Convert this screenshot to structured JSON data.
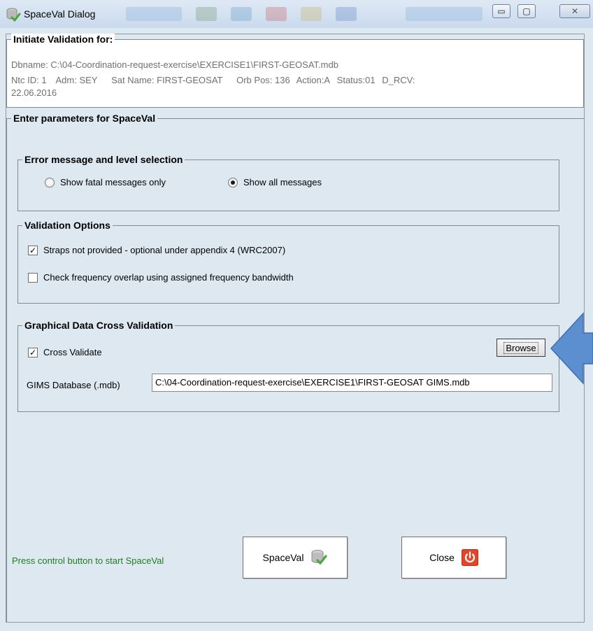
{
  "window": {
    "title": "SpaceVal Dialog",
    "minimize_glyph": "▭",
    "maximize_glyph": "▢",
    "close_glyph": "✕"
  },
  "initiate": {
    "legend": "Initiate Validation for:",
    "dbname": "Dbname:  C:\\04-Coordination-request-exercise\\EXERCISE1\\FIRST-GEOSAT.mdb",
    "ntc_id": "Ntc ID: 1",
    "adm": "Adm: SEY",
    "sat_name": "Sat Name:  FIRST-GEOSAT",
    "orb_pos": "Orb Pos: 136",
    "action": "Action:A",
    "status": "Status:01",
    "d_rcv": "D_RCV:",
    "date": "22.06.2016"
  },
  "params": {
    "legend": "Enter parameters for SpaceVal"
  },
  "error_level": {
    "legend": "Error message and level selection",
    "option_fatal": "Show fatal messages only",
    "option_all": "Show all messages",
    "selected": "all"
  },
  "validation_options": {
    "legend": "Validation Options",
    "straps_label": "Straps not provided - optional under appendix 4 (WRC2007)",
    "straps_checked": true,
    "overlap_label": "Check frequency overlap using assigned frequency bandwidth",
    "overlap_checked": false
  },
  "graphical": {
    "legend": "Graphical Data Cross Validation",
    "cross_validate_label": "Cross Validate",
    "cross_validate_checked": true,
    "browse_label": "Browse",
    "gims_label": "GIMS Database (.mdb)",
    "gims_value": "C:\\04-Coordination-request-exercise\\EXERCISE1\\FIRST-GEOSAT GIMS.mdb"
  },
  "footer": {
    "status_text": "Press control button to start SpaceVal",
    "spaceval_button": "SpaceVal",
    "close_button": "Close"
  },
  "colors": {
    "dialog_bg": "#dde8f1",
    "status_text": "#1f7d1f",
    "arrow": "#5b8fcf",
    "close_icon": "#e3452a"
  }
}
